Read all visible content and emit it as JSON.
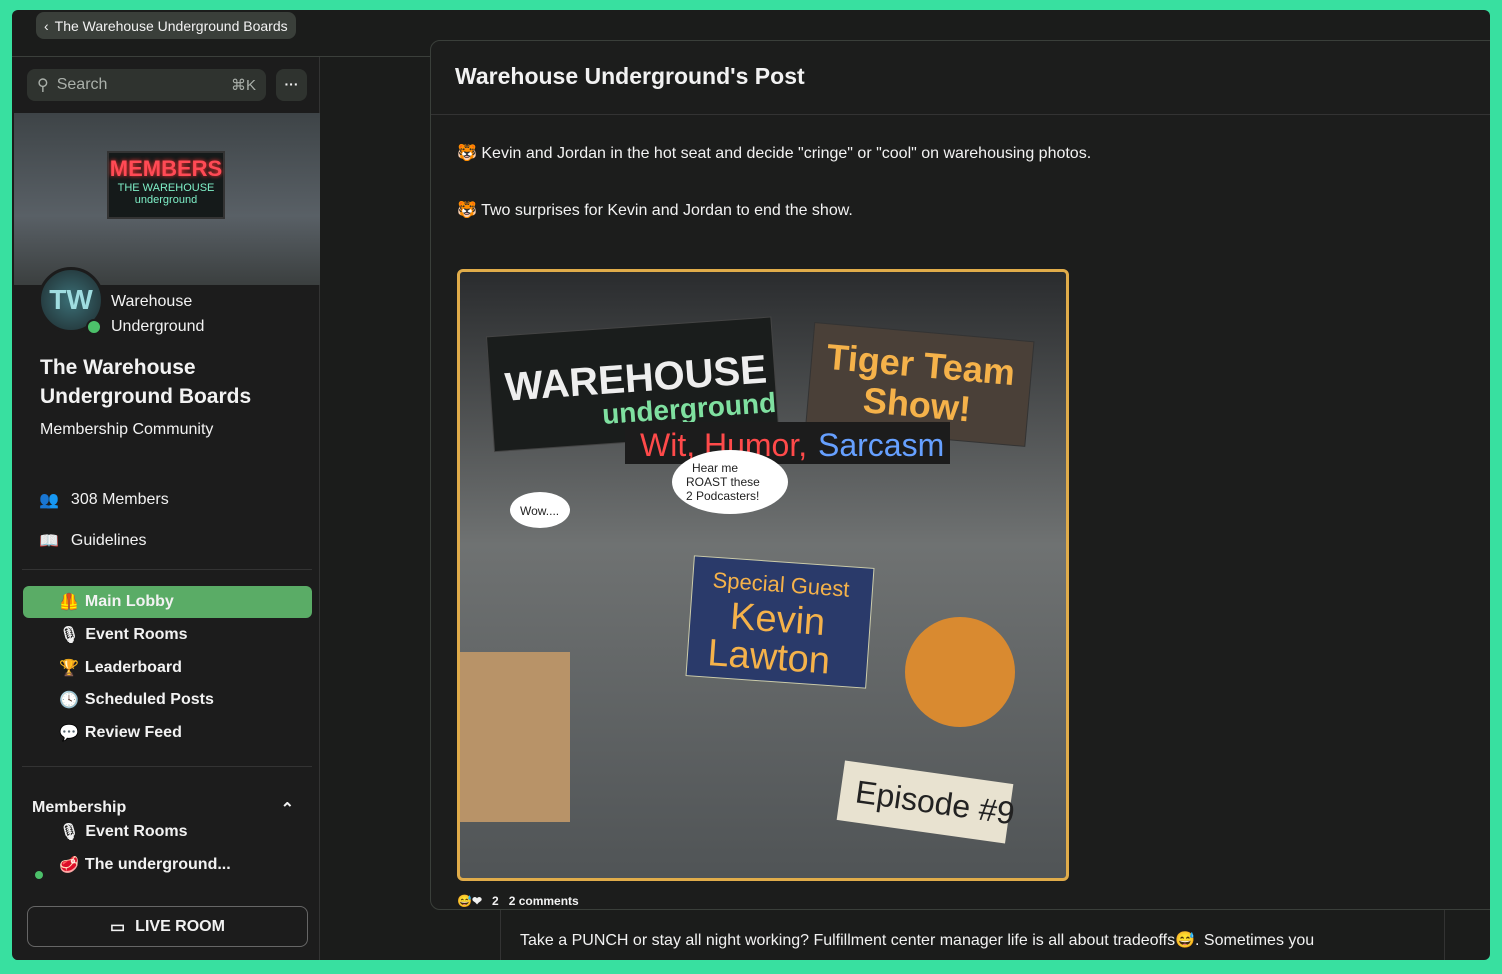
{
  "breadcrumb": {
    "label": "The Warehouse Underground Boards"
  },
  "search": {
    "placeholder": "Search",
    "shortcut": "⌘K"
  },
  "more_label": "···",
  "banner_text": [
    "MEMBERS",
    "THE WAREHOUSE",
    "underground"
  ],
  "community": {
    "avatar_letters": "TW",
    "author": "Warehouse Underground",
    "title": "The Warehouse Underground Boards",
    "subtitle": "Membership Community",
    "members": "308 Members",
    "guidelines": "Guidelines"
  },
  "nav": [
    {
      "emoji": "🦺",
      "label": "Main Lobby",
      "active": true
    },
    {
      "emoji": "🎙",
      "label": "Event Rooms"
    },
    {
      "emoji": "🏆",
      "label": "Leaderboard"
    },
    {
      "emoji": "🕓",
      "label": "Scheduled Posts"
    },
    {
      "emoji": "💬",
      "label": "Review Feed"
    }
  ],
  "membership": {
    "title": "Membership",
    "items": [
      {
        "emoji": "🎙",
        "label": "Event Rooms"
      },
      {
        "emoji": "🥩",
        "label": "The underground..."
      }
    ]
  },
  "live_room": "LIVE ROOM",
  "post": {
    "title": "Warehouse Underground's Post",
    "paragraphs": [
      "🐯 Kevin and Jordan in the hot seat and decide \"cringe\" or \"cool\" on warehousing photos.",
      "🐯 Two surprises for Kevin and Jordan to end the show."
    ],
    "image_text": [
      "THE WAREHOUSE underground",
      "Tiger Team Show!",
      "Wit, Humor, Sarcasm",
      "Special Guest Kevin Lawton",
      "Episode #9",
      "Hear me ROAST these 2 Podcasters!",
      "Wow...."
    ],
    "reactions": "😅❤ 2",
    "reaction_count": "2",
    "comments": "2 comments"
  },
  "feed_text": "Take a PUNCH or stay all night working? Fulfillment center manager life is all about tradeoffs😅. Sometimes you"
}
